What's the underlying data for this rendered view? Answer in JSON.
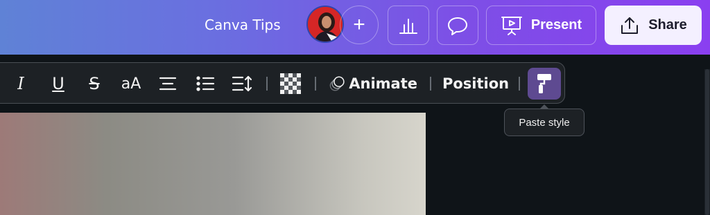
{
  "topbar": {
    "title": "Canva Tips",
    "add_label": "+",
    "present_label": "Present",
    "share_label": "Share"
  },
  "toolbar": {
    "italic": "I",
    "underline": "U",
    "strikethrough": "S",
    "case": "aA",
    "animate_label": "Animate",
    "position_label": "Position"
  },
  "tooltip": {
    "text": "Paste style"
  },
  "colors": {
    "gradient_start": "#5f82d6",
    "gradient_end": "#8a3ff0",
    "toolbar_bg": "#1d2125",
    "paste_active": "#5e4a91"
  }
}
